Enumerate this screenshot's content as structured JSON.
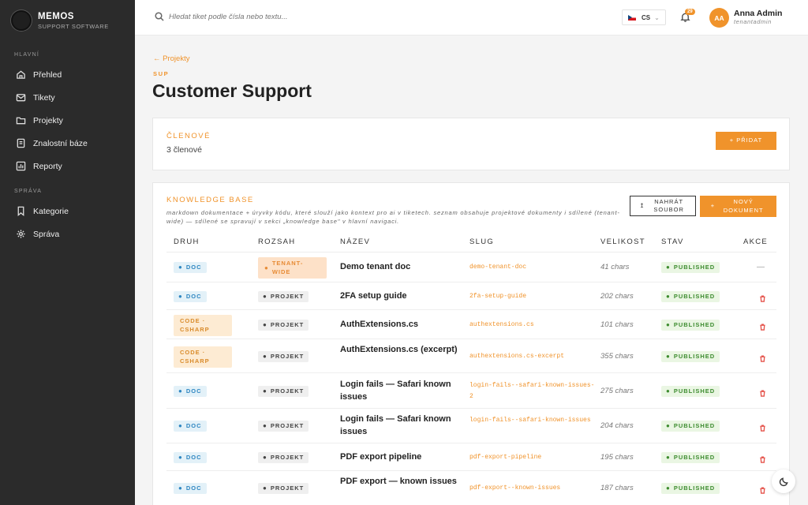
{
  "brand": {
    "name": "MEMOS",
    "sub": "SUPPORT SOFTWARE"
  },
  "sidebar": {
    "sections": [
      {
        "label": "HLAVNÍ",
        "items": [
          {
            "label": "Přehled",
            "icon": "home-icon"
          },
          {
            "label": "Tikety",
            "icon": "mail-icon"
          },
          {
            "label": "Projekty",
            "icon": "folder-icon"
          },
          {
            "label": "Znalostní báze",
            "icon": "book-icon"
          },
          {
            "label": "Reporty",
            "icon": "chart-icon"
          }
        ]
      },
      {
        "label": "SPRÁVA",
        "items": [
          {
            "label": "Kategorie",
            "icon": "bookmark-icon"
          },
          {
            "label": "Správa",
            "icon": "gear-icon"
          }
        ]
      }
    ]
  },
  "topbar": {
    "search_placeholder": "Hledat tiket podle čísla nebo textu...",
    "lang": "CS",
    "notifications": "29",
    "user": {
      "initials": "AA",
      "name": "Anna Admin",
      "role": "tenantadmin"
    }
  },
  "page": {
    "back": "← Projekty",
    "code": "SUP",
    "title": "Customer Support"
  },
  "members": {
    "title": "ČLENOVÉ",
    "count": "3 členové",
    "add_label": "+ PŘIDAT"
  },
  "kb": {
    "title": "KNOWLEDGE BASE",
    "description": "markdown dokumentace + úryvky kódu, které slouží jako kontext pro ai v tiketech. seznam obsahuje projektové dokumenty i sdílené (tenant-wide) — sdílené se spravují v sekci „knowledge base\" v hlavní navigaci.",
    "upload_label": "NAHRÁT SOUBOR",
    "new_label": "NOVÝ DOKUMENT",
    "columns": [
      "DRUH",
      "ROZSAH",
      "NÁZEV",
      "SLUG",
      "VELIKOST",
      "STAV",
      "AKCE"
    ],
    "rows": [
      {
        "kind": "DOC",
        "scope": "TENANT-WIDE",
        "name": "Demo tenant doc",
        "slug": "demo-tenant-doc",
        "size": "41 chars",
        "status": "PUBLISHED",
        "action": "—"
      },
      {
        "kind": "DOC",
        "scope": "PROJEKT",
        "name": "2FA setup guide",
        "slug": "2fa-setup-guide",
        "size": "202 chars",
        "status": "PUBLISHED",
        "action": "delete"
      },
      {
        "kind": "CODE · CSHARP",
        "scope": "PROJEKT",
        "name": "AuthExtensions.cs",
        "slug": "authextensions.cs",
        "size": "101 chars",
        "status": "PUBLISHED",
        "action": "delete"
      },
      {
        "kind": "CODE · CSHARP",
        "scope": "PROJEKT",
        "name": "AuthExtensions.cs (excerpt)",
        "slug": "authextensions.cs-excerpt",
        "size": "355 chars",
        "status": "PUBLISHED",
        "action": "delete"
      },
      {
        "kind": "DOC",
        "scope": "PROJEKT",
        "name": "Login fails — Safari known issues",
        "slug": "login-fails--safari-known-issues-2",
        "size": "275 chars",
        "status": "PUBLISHED",
        "action": "delete"
      },
      {
        "kind": "DOC",
        "scope": "PROJEKT",
        "name": "Login fails — Safari known issues",
        "slug": "login-fails--safari-known-issues",
        "size": "204 chars",
        "status": "PUBLISHED",
        "action": "delete"
      },
      {
        "kind": "DOC",
        "scope": "PROJEKT",
        "name": "PDF export pipeline",
        "slug": "pdf-export-pipeline",
        "size": "195 chars",
        "status": "PUBLISHED",
        "action": "delete"
      },
      {
        "kind": "DOC",
        "scope": "PROJEKT",
        "name": "PDF export — known issues",
        "slug": "pdf-export--known-issues",
        "size": "187 chars",
        "status": "PUBLISHED",
        "action": "delete"
      }
    ]
  },
  "colors": {
    "accent": "#f0932b",
    "sidebar": "#2b2b2b",
    "published": "#3d8c2f",
    "doc": "#2e86c1",
    "danger": "#e5534b"
  }
}
